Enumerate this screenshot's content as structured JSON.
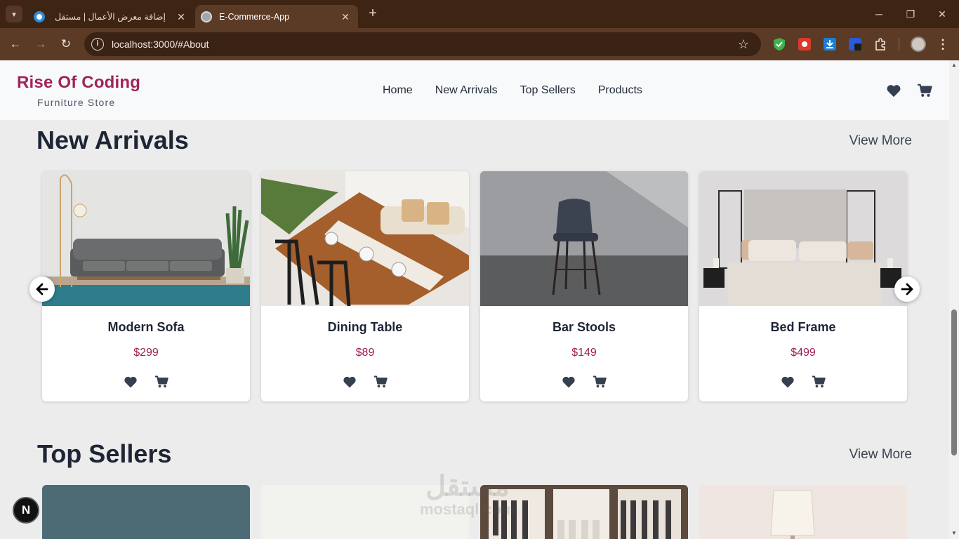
{
  "browser": {
    "tabs": [
      {
        "title": "إضافة معرض الأعمال | مستقل",
        "active": false
      },
      {
        "title": "E-Commerce-App",
        "active": true
      }
    ],
    "address": "localhost:3000/#About"
  },
  "site": {
    "brand": "Rise Of Coding",
    "tagline": "Furniture Store",
    "nav": [
      "Home",
      "New Arrivals",
      "Top Sellers",
      "Products"
    ],
    "accent_color": "#a1245a"
  },
  "new_arrivals": {
    "title": "New Arrivals",
    "view_more": "View More",
    "products": [
      {
        "name": "Modern Sofa",
        "price": "$299",
        "image": "sofa-photo"
      },
      {
        "name": "Dining Table",
        "price": "$89",
        "image": "dining-table-photo"
      },
      {
        "name": "Bar Stools",
        "price": "$149",
        "image": "bar-stool-photo"
      },
      {
        "name": "Bed Frame",
        "price": "$499",
        "image": "bed-photo"
      }
    ]
  },
  "top_sellers": {
    "title": "Top Sellers",
    "view_more": "View More"
  },
  "watermark": {
    "line1": "مستقل",
    "line2": "mostaql.com"
  },
  "dev_badge": "N"
}
